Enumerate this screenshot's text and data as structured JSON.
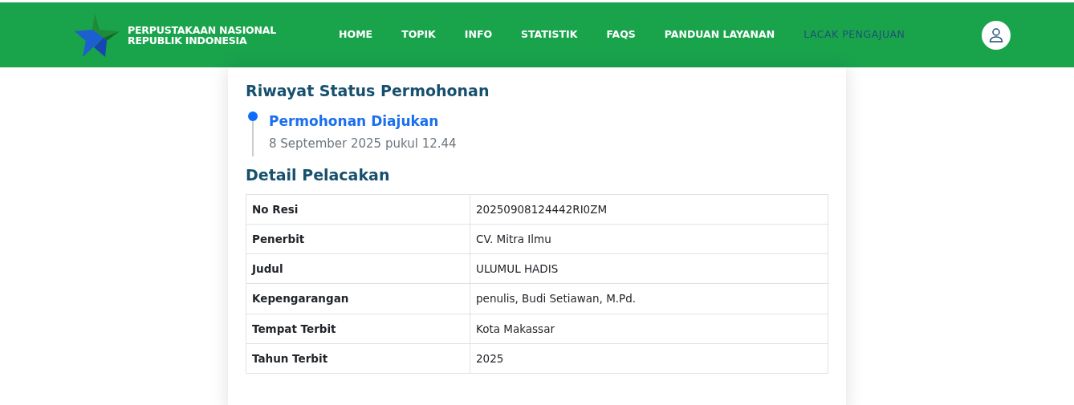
{
  "brand": {
    "line_1": "PERPUSTAKAAN NASIONAL",
    "line_2": "REPUBLIK INDONESIA"
  },
  "nav": [
    {
      "label": "HOME",
      "selected": false
    },
    {
      "label": "TOPIK",
      "selected": false
    },
    {
      "label": "INFO",
      "selected": false
    },
    {
      "label": "STATISTIK",
      "selected": false
    },
    {
      "label": "FAQS",
      "selected": false
    },
    {
      "label": "PANDUAN LAYANAN",
      "selected": false
    },
    {
      "label": "LACAK PENGAJUAN",
      "selected": true
    }
  ],
  "history": {
    "title": "Riwayat Status Permohonan",
    "events": [
      {
        "status": "Permohonan Diajukan",
        "time": "8 September 2025 pukul 12.44"
      }
    ]
  },
  "details": {
    "title": "Detail Pelacakan",
    "rows": [
      {
        "label": "No Resi",
        "value": "20250908124442RI0ZM"
      },
      {
        "label": "Penerbit",
        "value": "CV. Mitra Ilmu"
      },
      {
        "label": "Judul",
        "value": "ULUMUL HADIS"
      },
      {
        "label": "Kepengarangan",
        "value": "penulis, Budi Setiawan, M.Pd."
      },
      {
        "label": "Tempat Terbit",
        "value": "Kota Makassar"
      },
      {
        "label": "Tahun Terbit",
        "value": "2025"
      }
    ]
  }
}
